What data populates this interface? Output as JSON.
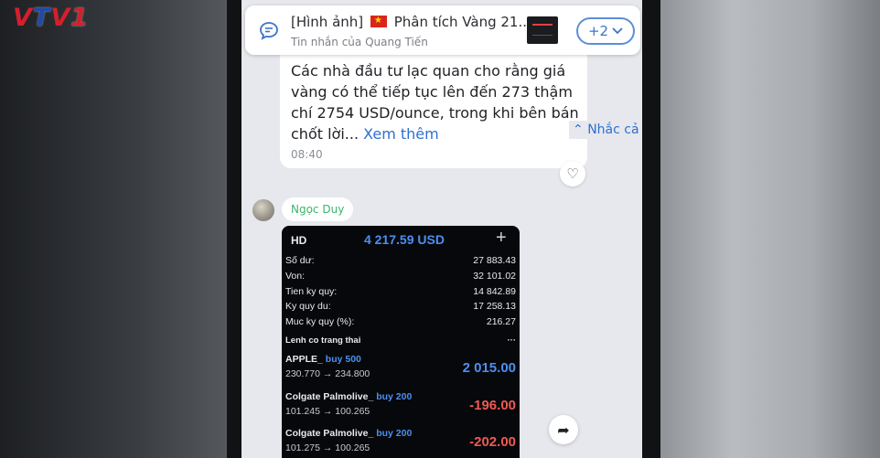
{
  "broadcaster_logo": "VTV1",
  "pinned": {
    "title_prefix": "[Hình ảnh]",
    "title_rest": "Phân tích Vàng 21...",
    "subtitle": "Tin nhắn của Quang Tiến",
    "more_label": "+2",
    "chat_icon": "chat-bubble-icon",
    "chevron_icon": "chevron-down-icon"
  },
  "message": {
    "text": "Các nhà đầu tư lạc quan cho rằng giá vàng có thể tiếp tục lên đến 273 thậm chí 2754 USD/ounce, trong khi bên bán chốt lời...",
    "see_more": "Xem thêm",
    "time": "08:40",
    "mention_all": "Nhắc cả nhóm",
    "mention_icon": "double-chevron-up-icon",
    "reaction_icon": "heart-icon"
  },
  "sender": {
    "name": "Ngọc Duy"
  },
  "trade": {
    "account": "HD",
    "balance_header": "4 217.59 USD",
    "plus": "+",
    "rows": [
      {
        "label": "Số dư:",
        "value": "27 883.43"
      },
      {
        "label": "Von:",
        "value": "32 101.02"
      },
      {
        "label": "Tien ky quy:",
        "value": "14 842.89"
      },
      {
        "label": "Ky quy du:",
        "value": "17 258.13"
      },
      {
        "label": "Muc ky quy (%):",
        "value": "216.27"
      }
    ],
    "section": "Lenh co trang thai",
    "section_more": "···",
    "orders": [
      {
        "name": "APPLE_",
        "side": "buy 500",
        "price": "230.770 → 234.800",
        "pl": "2 015.00",
        "dir": "up"
      },
      {
        "name": "Colgate Palmolive_",
        "side": "buy 200",
        "price": "101.245 → 100.265",
        "pl": "-196.00",
        "dir": "down"
      },
      {
        "name": "Colgate Palmolive_",
        "side": "buy 200",
        "price": "101.275 → 100.265",
        "pl": "-202.00",
        "dir": "down"
      }
    ]
  },
  "share_icon": "share-arrow-icon",
  "colors": {
    "logo_red": "#d3202c",
    "logo_blue": "#1f4aa8",
    "link_blue": "#2f6fd0",
    "sender_green": "#3bb46a",
    "profit_blue": "#4d8ff0",
    "loss_red": "#ef5a52"
  }
}
